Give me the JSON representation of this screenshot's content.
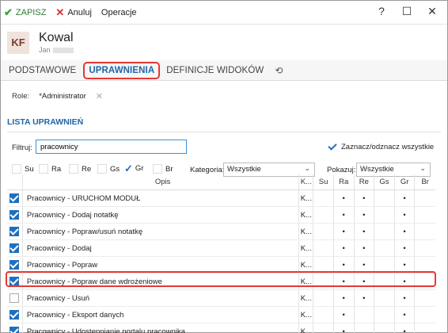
{
  "toolbar": {
    "save_label": "ZAPISZ",
    "cancel_label": "Anuluj",
    "ops_label": "Operacje"
  },
  "window_controls": {
    "help": "?",
    "maximize": "☐",
    "close": "✕"
  },
  "header": {
    "initials": "KF",
    "name": "Kowal",
    "subtitle": "Jan"
  },
  "tabs": [
    {
      "label": "PODSTAWOWE",
      "active": false
    },
    {
      "label": "UPRAWNIENIA",
      "active": true
    },
    {
      "label": "DEFINICJE WIDOKÓW",
      "active": false
    }
  ],
  "role": {
    "label": "Role:",
    "value": "*Administrator"
  },
  "section_title": "LISTA UPRAWNIEŃ",
  "filter": {
    "label": "Filtruj:",
    "value": "pracownicy"
  },
  "toggle_all_label": "Zaznacz/odznacz wszystkie",
  "perm_options": [
    {
      "label": "Su",
      "checked": false
    },
    {
      "label": "Ra",
      "checked": false
    },
    {
      "label": "Re",
      "checked": false
    },
    {
      "label": "Gs",
      "checked": false
    },
    {
      "label": "Gr",
      "checked": true
    },
    {
      "label": "Br",
      "checked": false
    }
  ],
  "category": {
    "label": "Kategoria:",
    "value": "Wszystkie"
  },
  "show": {
    "label": "Pokazuj:",
    "value": "Wszystkie"
  },
  "columns": [
    "Opis",
    "K...",
    "Su",
    "Ra",
    "Re",
    "Gs",
    "Gr",
    "Br"
  ],
  "rows": [
    {
      "checked": true,
      "opis": "Pracownicy - URUCHOM MODUŁ",
      "k": "K...",
      "flags": [
        "",
        "•",
        "•",
        "",
        "•",
        ""
      ]
    },
    {
      "checked": true,
      "opis": "Pracownicy - Dodaj notatkę",
      "k": "K...",
      "flags": [
        "",
        "•",
        "•",
        "",
        "•",
        ""
      ]
    },
    {
      "checked": true,
      "opis": "Pracownicy - Popraw/usuń notatkę",
      "k": "K...",
      "flags": [
        "",
        "•",
        "•",
        "",
        "•",
        ""
      ]
    },
    {
      "checked": true,
      "opis": "Pracownicy - Dodaj",
      "k": "K...",
      "flags": [
        "",
        "•",
        "•",
        "",
        "•",
        ""
      ]
    },
    {
      "checked": true,
      "opis": "Pracownicy - Popraw",
      "k": "K...",
      "flags": [
        "",
        "•",
        "•",
        "",
        "•",
        ""
      ]
    },
    {
      "checked": true,
      "opis": "Pracownicy - Popraw dane wdrożeniowe",
      "k": "K...",
      "flags": [
        "",
        "•",
        "•",
        "",
        "•",
        ""
      ]
    },
    {
      "checked": false,
      "opis": "Pracownicy - Usuń",
      "k": "K...",
      "flags": [
        "",
        "•",
        "•",
        "",
        "•",
        ""
      ]
    },
    {
      "checked": true,
      "opis": "Pracownicy - Eksport danych",
      "k": "K...",
      "flags": [
        "",
        "•",
        "",
        "",
        "•",
        ""
      ]
    },
    {
      "checked": true,
      "opis": "Pracownicy - Udostępnianie portalu pracownika",
      "k": "K...",
      "flags": [
        "",
        "•",
        "",
        "",
        "•",
        ""
      ]
    }
  ]
}
